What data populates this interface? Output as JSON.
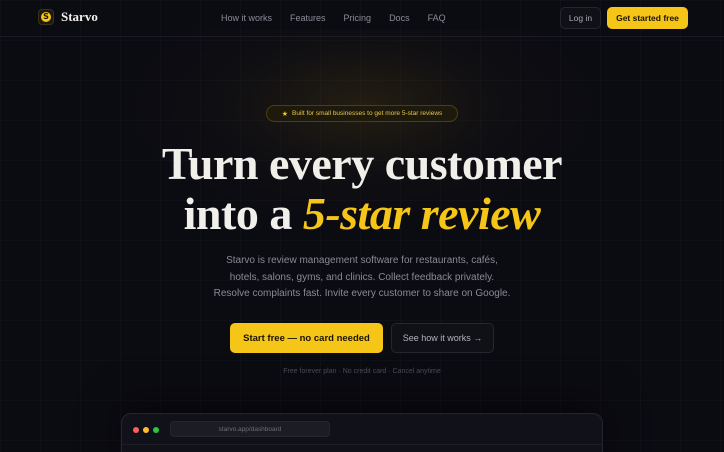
{
  "brand": {
    "name": "Starvo",
    "logo_glyph": "S",
    "logo_icon": "star-coin-icon"
  },
  "nav": {
    "links": [
      "How it works",
      "Features",
      "Pricing",
      "Docs",
      "FAQ"
    ],
    "login_label": "Log in",
    "cta_label": "Get started free"
  },
  "hero": {
    "badge_icon": "★",
    "badge_text": "Built for small businesses to get more 5-star reviews",
    "headline_line1": "Turn every customer",
    "headline_line2_prefix": "into a ",
    "headline_line2_accent": "5-star review",
    "subtext": [
      "Starvo is review management software for restaurants, cafés,",
      "hotels, salons, gyms, and clinics. Collect feedback privately.",
      "Resolve complaints fast. Invite every customer to share on Google."
    ],
    "primary_cta": "Start free — no card needed",
    "secondary_cta": "See how it works →",
    "fine_print": "Free forever plan · No credit card · Cancel anytime"
  },
  "preview": {
    "url": "starvo.app/dashboard",
    "window_dot_colors": [
      "#ff5f57",
      "#febc2e",
      "#28c840"
    ]
  },
  "colors": {
    "accent": "#f5c518",
    "background": "#0b0b12"
  }
}
